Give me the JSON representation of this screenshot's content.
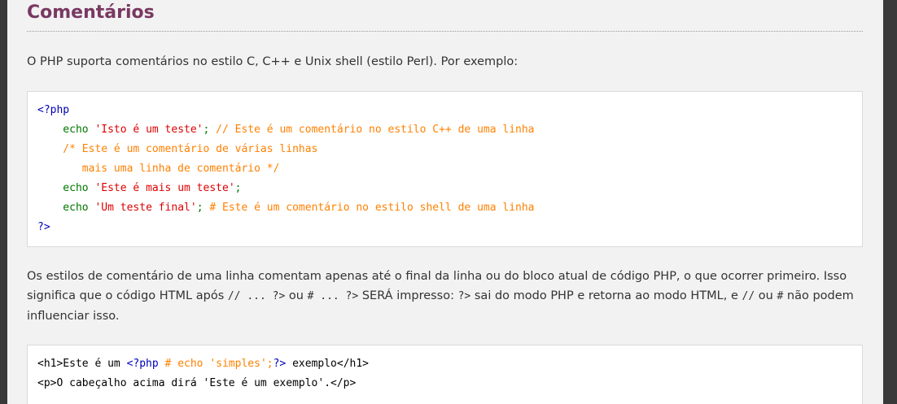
{
  "section": {
    "title": "Comentários"
  },
  "para1": "O PHP suporta comentários no estilo C, C++ e Unix shell (estilo Perl). Por exemplo:",
  "example1": {
    "lines": [
      [
        {
          "t": "php",
          "v": "<?php"
        }
      ],
      [
        {
          "t": "kw",
          "v": "    echo "
        },
        {
          "t": "str",
          "v": "'Isto é um teste'"
        },
        {
          "t": "kw",
          "v": "; "
        },
        {
          "t": "cmt",
          "v": "// Este é um comentário no estilo C++ de uma linha"
        }
      ],
      [
        {
          "t": "cmt",
          "v": "    /* Este é um comentário de várias linhas"
        }
      ],
      [
        {
          "t": "cmt",
          "v": "       mais uma linha de comentário */"
        }
      ],
      [
        {
          "t": "kw",
          "v": "    echo "
        },
        {
          "t": "str",
          "v": "'Este é mais um teste'"
        },
        {
          "t": "kw",
          "v": ";"
        }
      ],
      [
        {
          "t": "kw",
          "v": "    echo "
        },
        {
          "t": "str",
          "v": "'Um teste final'"
        },
        {
          "t": "kw",
          "v": "; "
        },
        {
          "t": "cmt",
          "v": "# Este é um comentário no estilo shell de uma linha"
        }
      ],
      [
        {
          "t": "php",
          "v": "?>"
        }
      ]
    ]
  },
  "para2": {
    "text_a": "Os estilos de comentário de uma linha comentam apenas até o final da linha ou do bloco atual de código PHP, o que ocorrer primeiro. Isso significa que o código HTML após ",
    "code_a": "// ... ?>",
    "text_b": " ou ",
    "code_b": "# ... ?>",
    "text_c": " SERÁ impresso: ",
    "code_c": "?>",
    "text_d": " sai do modo PHP e retorna ao modo HTML, e ",
    "code_d": "//",
    "text_e": " ou ",
    "code_e": "#",
    "text_f": " não podem influenciar isso."
  },
  "example2": {
    "lines": [
      [
        {
          "t": "txt",
          "v": "<h1>Este é um "
        },
        {
          "t": "php",
          "v": "<?php "
        },
        {
          "t": "cmt",
          "v": "# echo 'simples';"
        },
        {
          "t": "php",
          "v": "?>"
        },
        {
          "t": "txt",
          "v": " exemplo</h1>"
        }
      ],
      [
        {
          "t": "txt",
          "v": "<p>O cabeçalho acima dirá 'Este é um exemplo'.</p>"
        }
      ]
    ]
  }
}
